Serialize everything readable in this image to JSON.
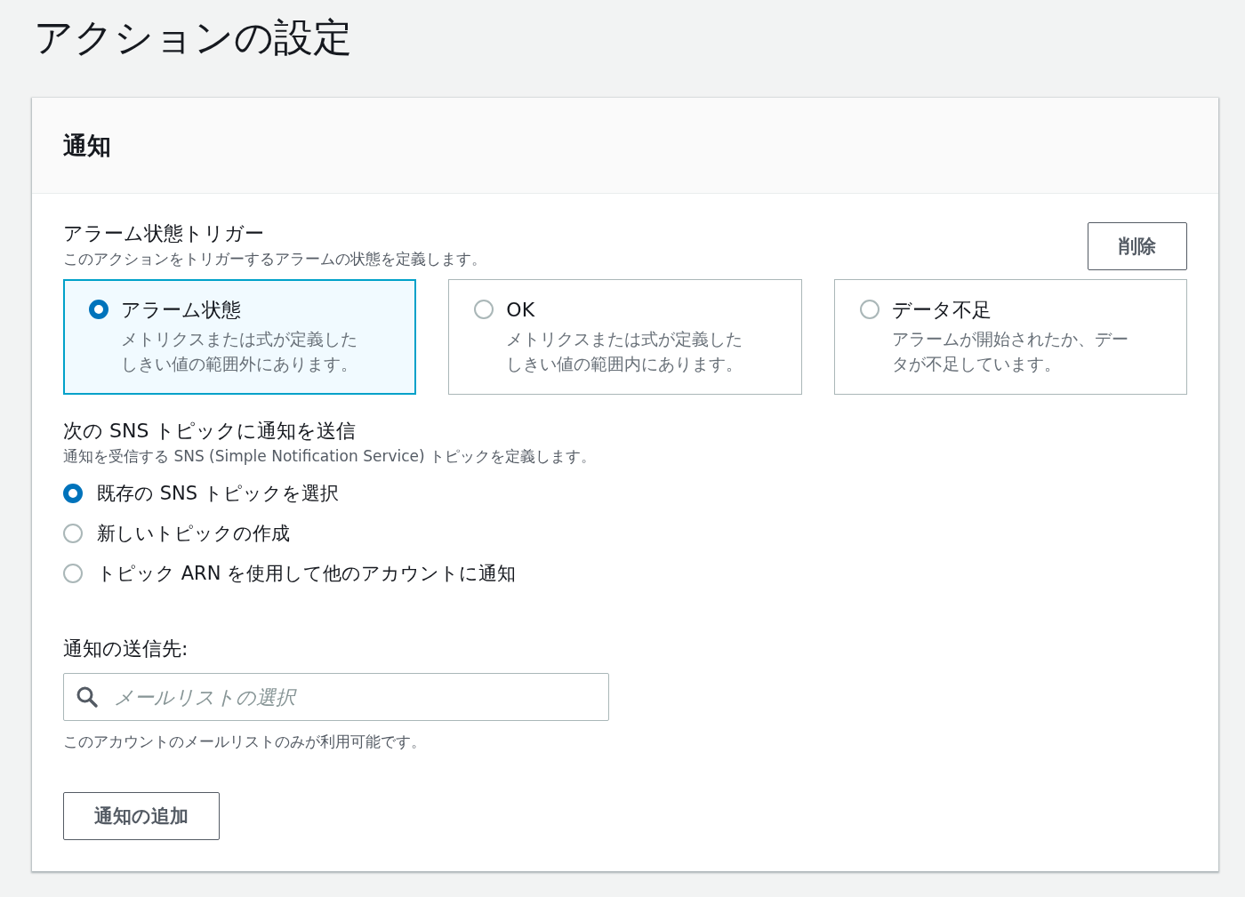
{
  "page_title": "アクションの設定",
  "panel": {
    "title": "通知",
    "trigger": {
      "label": "アラーム状態トリガー",
      "description": "このアクションをトリガーするアラームの状態を定義します。",
      "remove_button": "削除",
      "options": [
        {
          "title": "アラーム状態",
          "description": "メトリクスまたは式が定義したしきい値の範囲外にあります。",
          "selected": true
        },
        {
          "title": "OK",
          "description": "メトリクスまたは式が定義したしきい値の範囲内にあります。",
          "selected": false
        },
        {
          "title": "データ不足",
          "description": "アラームが開始されたか、データが不足しています。",
          "selected": false
        }
      ]
    },
    "sns": {
      "label": "次の SNS トピックに通知を送信",
      "description": "通知を受信する SNS (Simple Notification Service) トピックを定義します。",
      "options": [
        {
          "label": "既存の SNS トピックを選択",
          "selected": true
        },
        {
          "label": "新しいトピックの作成",
          "selected": false
        },
        {
          "label": "トピック ARN を使用して他のアカウントに通知",
          "selected": false
        }
      ]
    },
    "recipient": {
      "label": "通知の送信先:",
      "placeholder": "メールリストの選択",
      "hint": "このアカウントのメールリストのみが利用可能です。"
    },
    "add_button": "通知の追加"
  }
}
